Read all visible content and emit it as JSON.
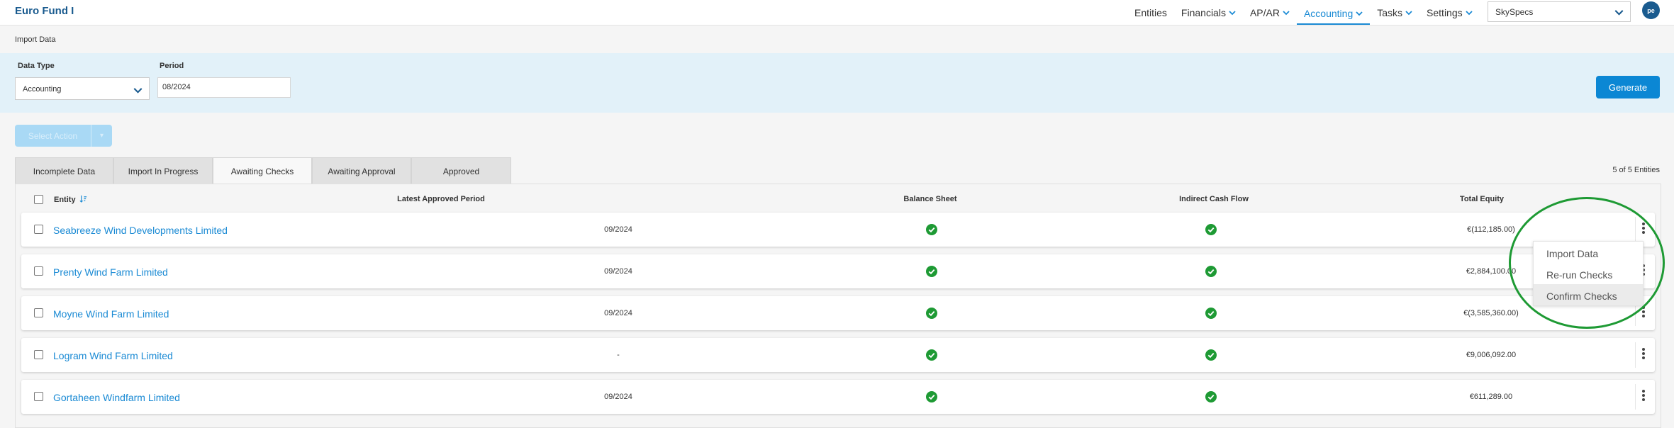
{
  "app": {
    "title": "Euro Fund I"
  },
  "nav": {
    "items": [
      {
        "label": "Entities",
        "dropdown": false,
        "active": false
      },
      {
        "label": "Financials",
        "dropdown": true,
        "active": false
      },
      {
        "label": "AP/AR",
        "dropdown": true,
        "active": false
      },
      {
        "label": "Accounting",
        "dropdown": true,
        "active": true
      },
      {
        "label": "Tasks",
        "dropdown": true,
        "active": false
      },
      {
        "label": "Settings",
        "dropdown": true,
        "active": false
      }
    ],
    "company_select": "SkySpecs",
    "avatar_initials": "pe"
  },
  "breadcrumb": "Import Data",
  "filters": {
    "data_type_label": "Data Type",
    "data_type_value": "Accounting",
    "period_label": "Period",
    "period_value": "08/2024",
    "generate_label": "Generate"
  },
  "actions": {
    "select_action_label": "Select Action"
  },
  "tabs": [
    {
      "label": "Incomplete Data",
      "active": false
    },
    {
      "label": "Import In Progress",
      "active": false
    },
    {
      "label": "Awaiting Checks",
      "active": true
    },
    {
      "label": "Awaiting Approval",
      "active": false
    },
    {
      "label": "Approved",
      "active": false
    }
  ],
  "entity_count": "5 of 5 Entities",
  "table": {
    "columns": [
      "Entity",
      "Latest Approved Period",
      "Balance Sheet",
      "Indirect Cash Flow",
      "Total Equity"
    ],
    "rows": [
      {
        "entity": "Seabreeze Wind Developments Limited",
        "period": "09/2024",
        "balance_sheet": "ok",
        "cash_flow": "ok",
        "equity": "€(112,185.00)"
      },
      {
        "entity": "Prenty Wind Farm Limited",
        "period": "09/2024",
        "balance_sheet": "ok",
        "cash_flow": "ok",
        "equity": "€2,884,100.00"
      },
      {
        "entity": "Moyne Wind Farm Limited",
        "period": "09/2024",
        "balance_sheet": "ok",
        "cash_flow": "ok",
        "equity": "€(3,585,360.00)"
      },
      {
        "entity": "Logram Wind Farm Limited",
        "period": "-",
        "balance_sheet": "ok",
        "cash_flow": "ok",
        "equity": "€9,006,092.00"
      },
      {
        "entity": "Gortaheen Windfarm Limited",
        "period": "09/2024",
        "balance_sheet": "ok",
        "cash_flow": "ok",
        "equity": "€611,289.00"
      }
    ]
  },
  "context_menu": {
    "items": [
      "Import Data",
      "Re-run Checks",
      "Confirm Checks"
    ],
    "hovered": "Confirm Checks"
  },
  "colors": {
    "brand": "#1a5b8f",
    "accent": "#0b87d4",
    "link": "#1a8ad4",
    "success": "#1e9a34",
    "highlight": "#1e9a34",
    "filter_panel": "#e2f1f9"
  }
}
